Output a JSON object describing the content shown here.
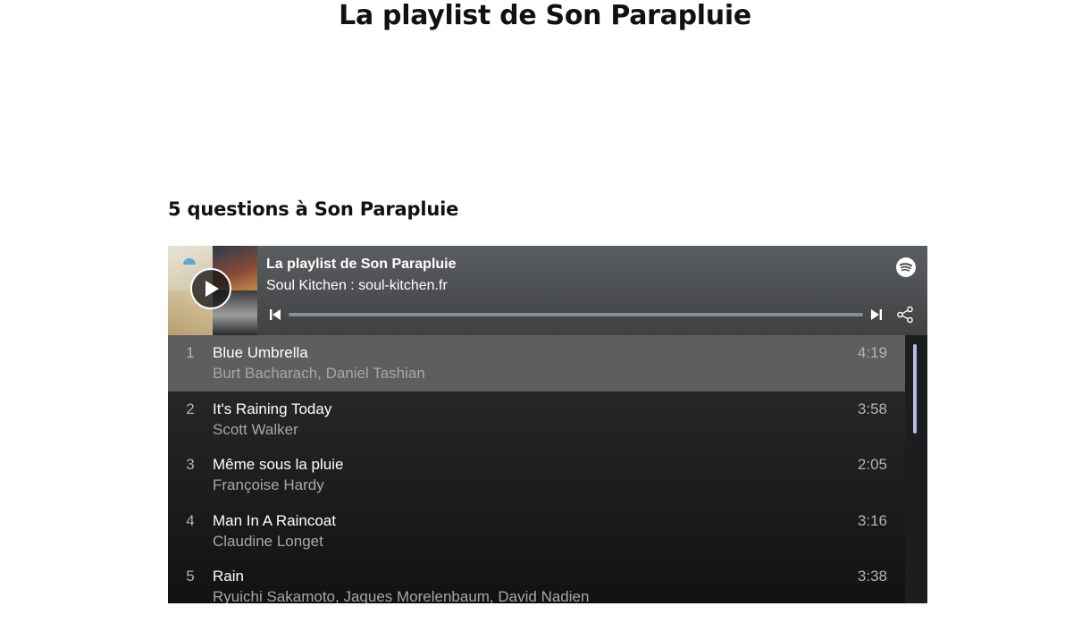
{
  "page": {
    "title": "La playlist de Son Parapluie",
    "section_title": "5 questions à Son Parapluie"
  },
  "player": {
    "playlist_title": "La playlist de Son Parapluie",
    "owner": "Soul Kitchen : soul-kitchen.fr",
    "icons": {
      "play": "play-icon",
      "prev": "skip-back-icon",
      "next": "skip-forward-icon",
      "share": "share-icon",
      "brand": "spotify-icon"
    },
    "progress": 0,
    "colors": {
      "header": "#4e5153",
      "list_bg": "#1f2021",
      "active_row": "#5c5e5f",
      "scroll_thumb": "#b9b9e6"
    },
    "tracks": [
      {
        "num": "1",
        "title": "Blue Umbrella",
        "artist": "Burt Bacharach, Daniel Tashian",
        "duration": "4:19",
        "active": true
      },
      {
        "num": "2",
        "title": "It's Raining Today",
        "artist": "Scott Walker",
        "duration": "3:58",
        "active": false
      },
      {
        "num": "3",
        "title": "Même sous la pluie",
        "artist": "Françoise Hardy",
        "duration": "2:05",
        "active": false
      },
      {
        "num": "4",
        "title": "Man In A Raincoat",
        "artist": "Claudine Longet",
        "duration": "3:16",
        "active": false
      },
      {
        "num": "5",
        "title": "Rain",
        "artist": "Ryuichi Sakamoto, Jaques Morelenbaum, David Nadien",
        "duration": "3:38",
        "active": false
      }
    ]
  }
}
